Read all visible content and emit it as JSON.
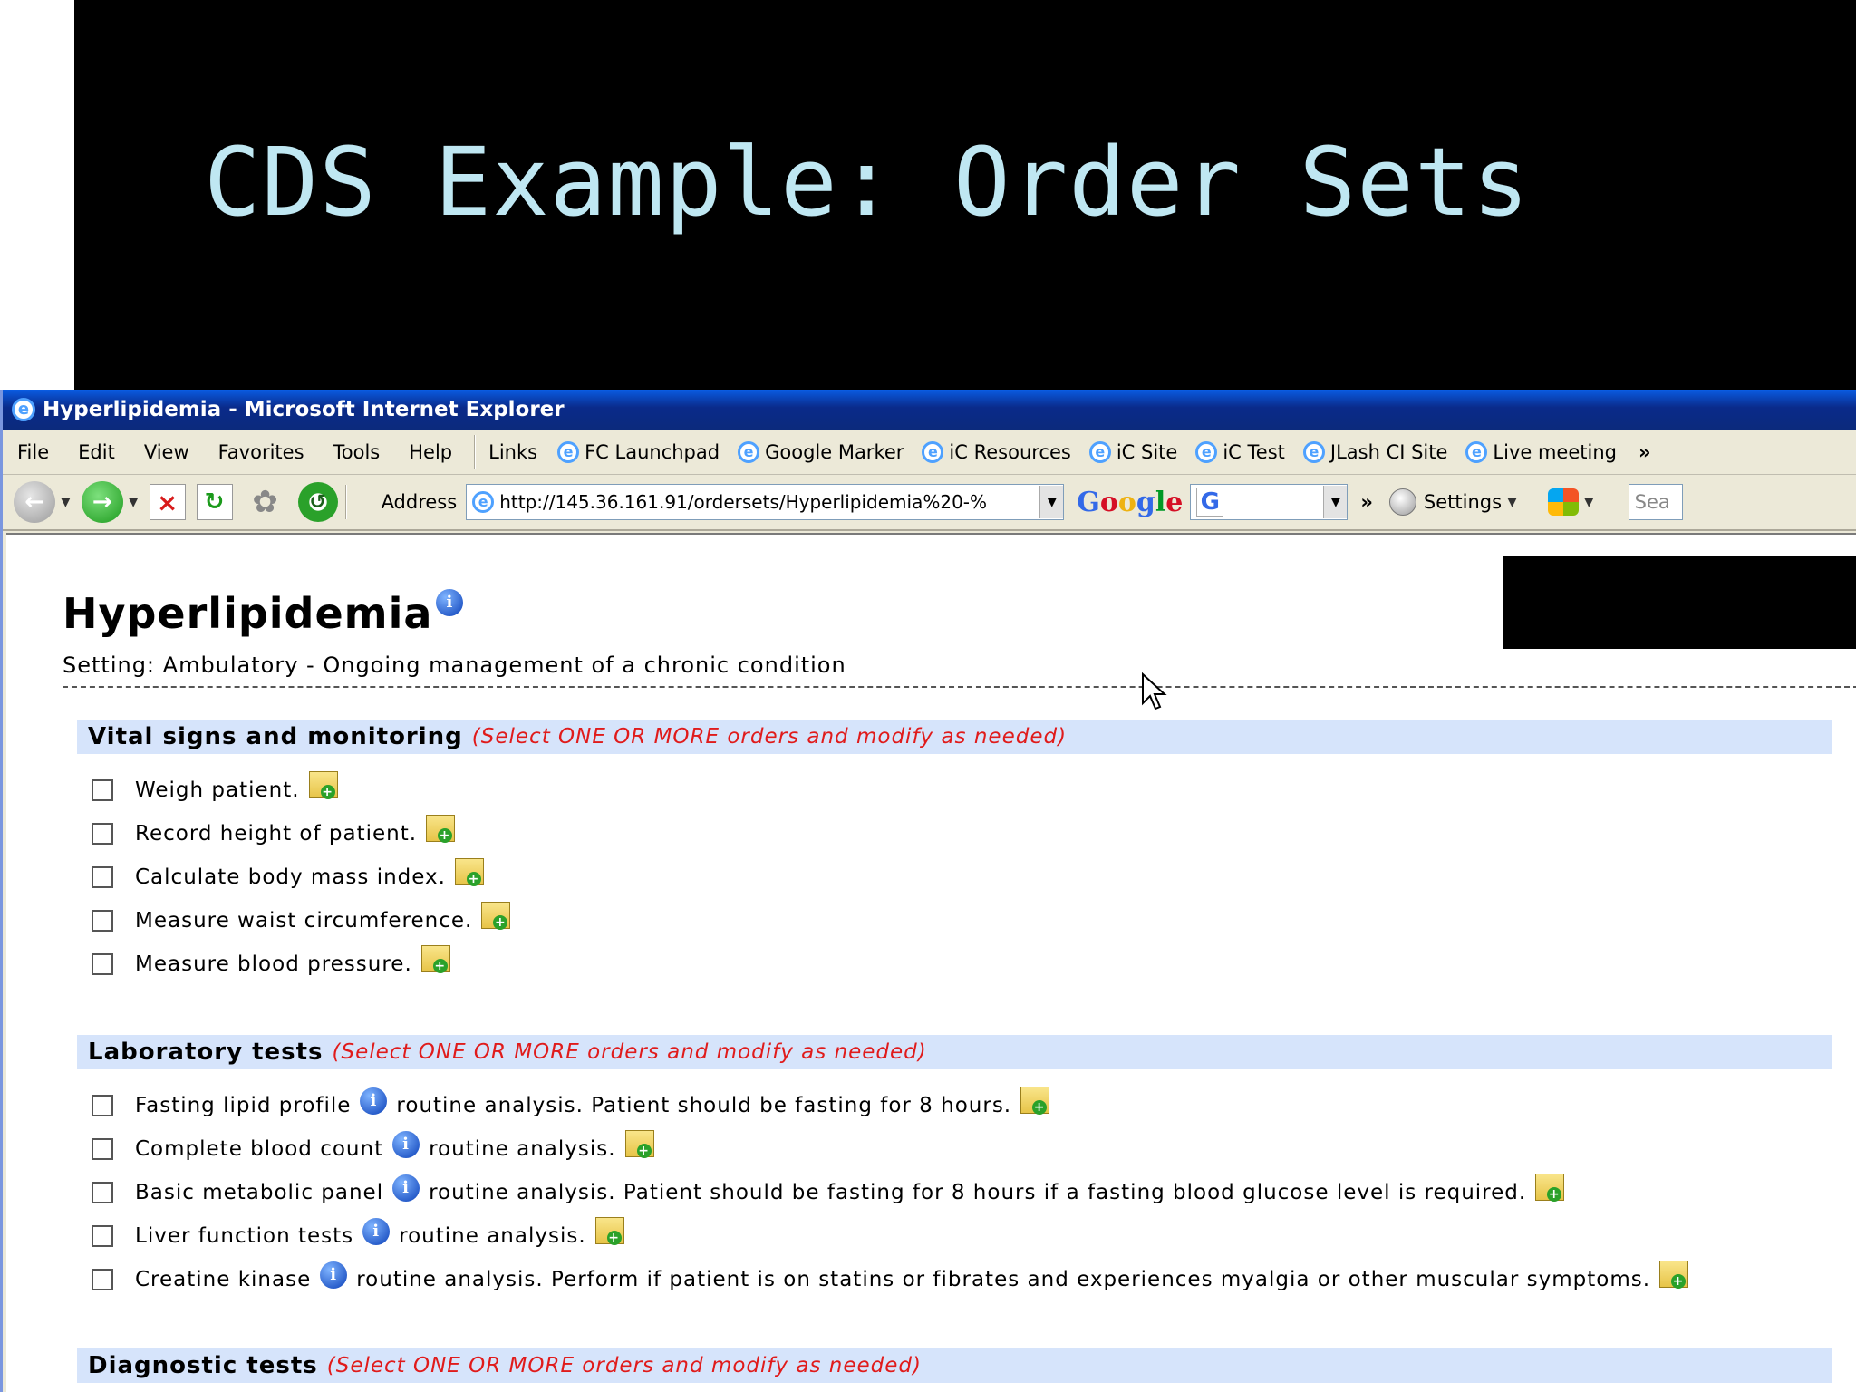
{
  "slide": {
    "title": "CDS Example: Order Sets"
  },
  "window": {
    "title": "Hyperlipidemia - Microsoft Internet Explorer"
  },
  "menu": [
    "File",
    "Edit",
    "View",
    "Favorites",
    "Tools",
    "Help"
  ],
  "links": {
    "label": "Links",
    "items": [
      "FC Launchpad",
      "Google Marker",
      "iC Resources",
      "iC Site",
      "iC Test",
      "JLash CI Site",
      "Live meeting"
    ]
  },
  "toolbar": {
    "address_label": "Address",
    "address_value": "http://145.36.161.91/ordersets/Hyperlipidemia%20-%",
    "google_g": "G",
    "settings_label": "Settings",
    "search_placeholder": "Sea"
  },
  "page": {
    "title": "Hyperlipidemia",
    "setting": "Setting: Ambulatory - Ongoing management of a chronic condition",
    "sections": [
      {
        "title": "Vital signs and monitoring",
        "hint": "(Select ONE OR MORE orders and modify as needed)",
        "items": [
          {
            "text": "Weigh patient."
          },
          {
            "text": "Record height of patient."
          },
          {
            "text": "Calculate body mass index."
          },
          {
            "text": "Measure waist circumference."
          },
          {
            "text": "Measure blood pressure."
          }
        ]
      },
      {
        "title": "Laboratory tests",
        "hint": "(Select ONE OR MORE orders and modify as needed)",
        "items": [
          {
            "name": "Fasting lipid profile",
            "detail": "routine analysis. Patient should be fasting for 8 hours."
          },
          {
            "name": "Complete blood count",
            "detail": "routine analysis."
          },
          {
            "name": "Basic metabolic panel",
            "detail": "routine analysis. Patient should be fasting for 8 hours if a fasting blood glucose level is required."
          },
          {
            "name": "Liver function tests",
            "detail": "routine analysis."
          },
          {
            "name": "Creatine kinase",
            "detail": "routine analysis. Perform if patient is on statins or fibrates and experiences myalgia or other muscular symptoms."
          }
        ]
      },
      {
        "title": "Diagnostic tests",
        "hint": "(Select ONE OR MORE orders and modify as needed)"
      }
    ]
  }
}
